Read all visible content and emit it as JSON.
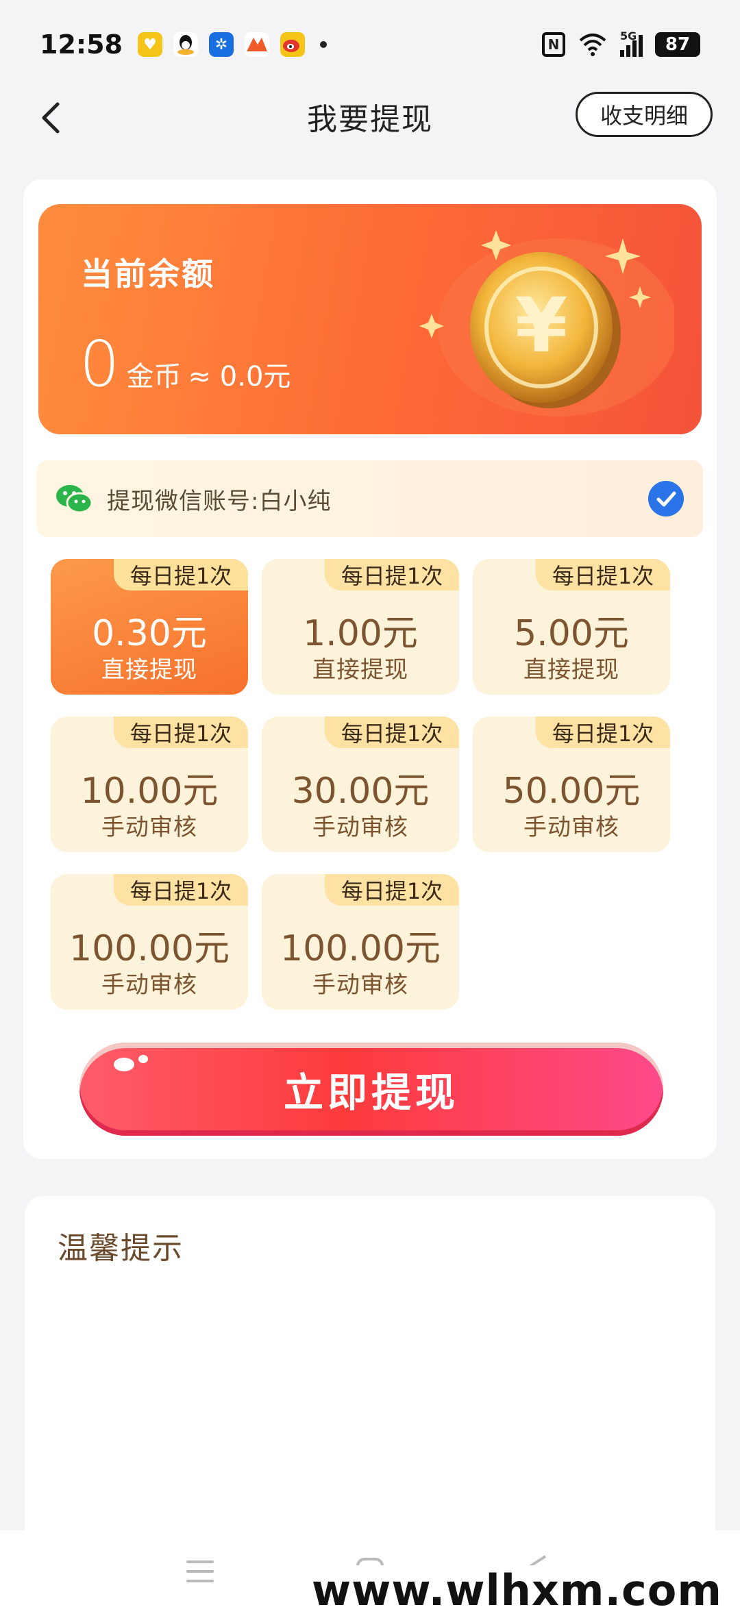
{
  "status_bar": {
    "time": "12:58",
    "network": "5G",
    "battery": "87"
  },
  "header": {
    "title": "我要提现",
    "detail_label": "收支明细"
  },
  "balance": {
    "label": "当前余额",
    "amount": "0",
    "unit": "金币",
    "approx": "≈ 0.0元"
  },
  "account": {
    "text": "提现微信账号:白小纯",
    "selected": true
  },
  "options": [
    {
      "tag": "每日提1次",
      "amount": "0.30元",
      "desc": "直接提现",
      "selected": true
    },
    {
      "tag": "每日提1次",
      "amount": "1.00元",
      "desc": "直接提现",
      "selected": false
    },
    {
      "tag": "每日提1次",
      "amount": "5.00元",
      "desc": "直接提现",
      "selected": false
    },
    {
      "tag": "每日提1次",
      "amount": "10.00元",
      "desc": "手动审核",
      "selected": false
    },
    {
      "tag": "每日提1次",
      "amount": "30.00元",
      "desc": "手动审核",
      "selected": false
    },
    {
      "tag": "每日提1次",
      "amount": "50.00元",
      "desc": "手动审核",
      "selected": false
    },
    {
      "tag": "每日提1次",
      "amount": "100.00元",
      "desc": "手动审核",
      "selected": false
    },
    {
      "tag": "每日提1次",
      "amount": "100.00元",
      "desc": "手动审核",
      "selected": false
    }
  ],
  "withdraw_button": {
    "label": "立即提现"
  },
  "tips": {
    "title": "温馨提示"
  },
  "watermark": "www.wlhxm.com",
  "colors": {
    "accent": "#fd6a36",
    "option_bg": "#fdf3db",
    "tag_bg": "#fde2a3",
    "check": "#2a73e8"
  }
}
